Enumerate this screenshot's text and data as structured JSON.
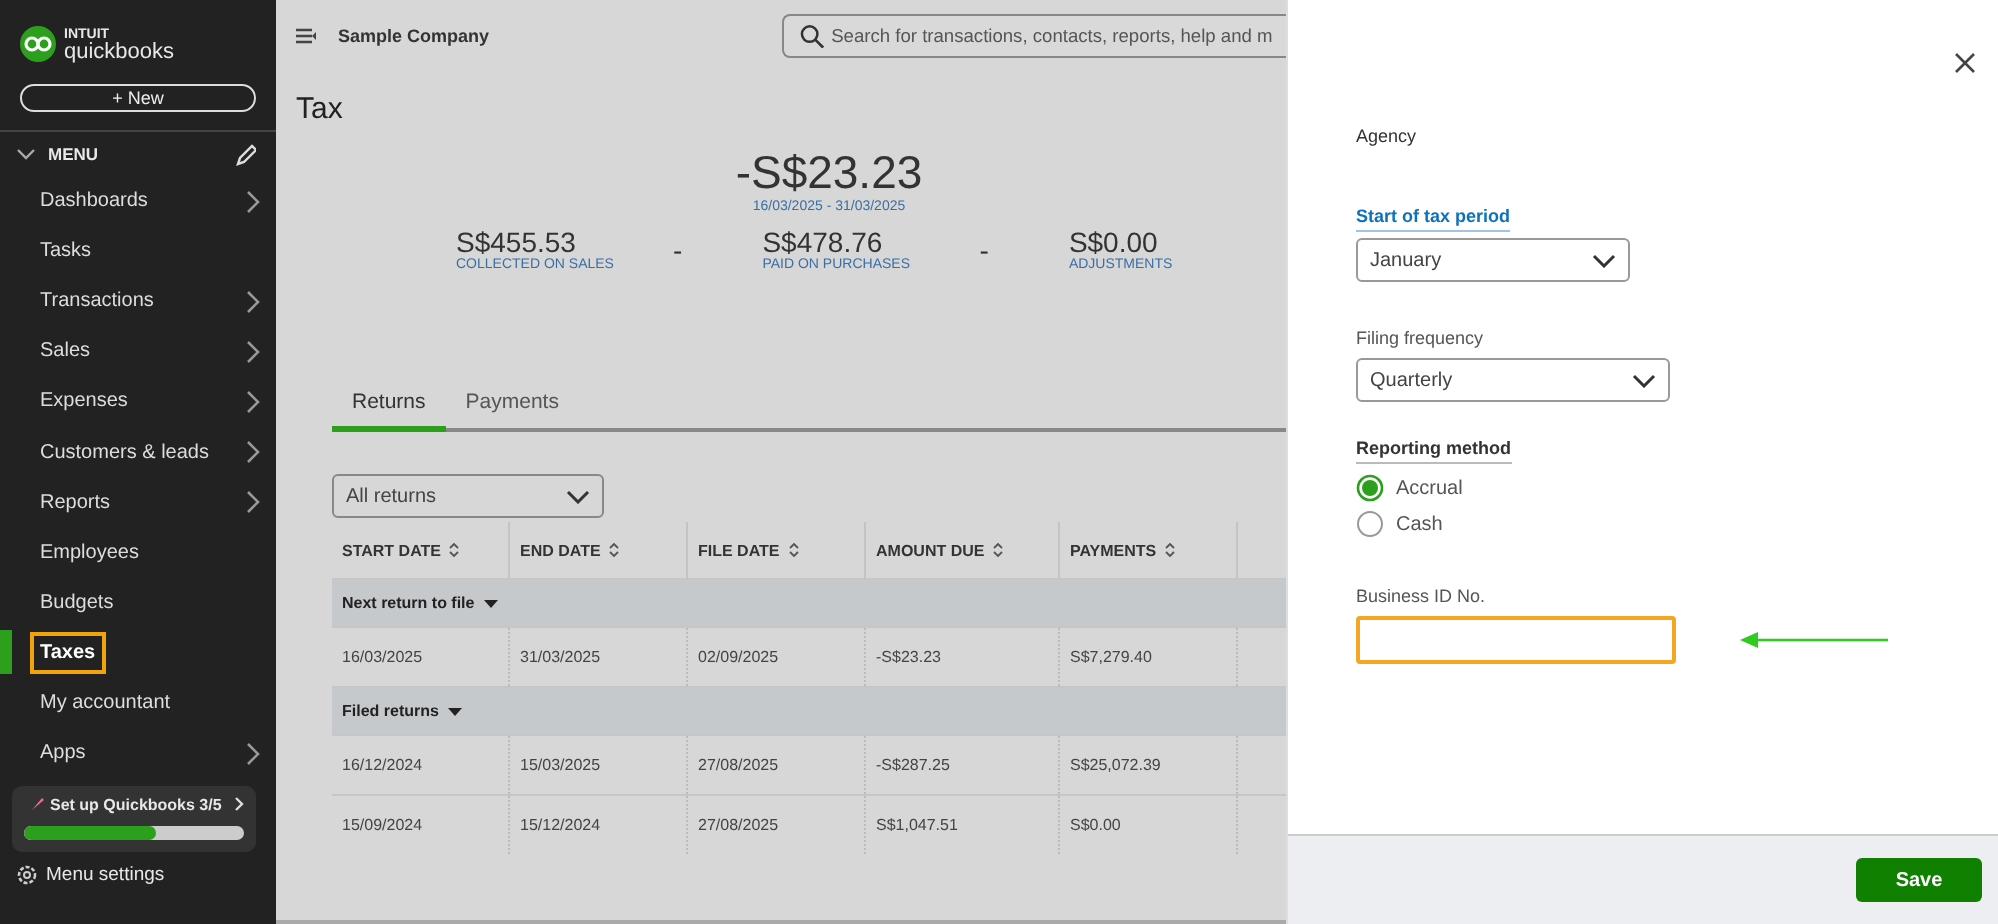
{
  "sidebar": {
    "logo_top": "INTUIT",
    "logo_name": "quickbooks",
    "new_button": "+ New",
    "menu_label": "MENU",
    "items": [
      {
        "label": "Dashboards",
        "expandable": true,
        "selected": false,
        "highlighted": false
      },
      {
        "label": "Tasks",
        "expandable": false,
        "selected": false,
        "highlighted": false
      },
      {
        "label": "Transactions",
        "expandable": true,
        "selected": false,
        "highlighted": false
      },
      {
        "label": "Sales",
        "expandable": true,
        "selected": false,
        "highlighted": false
      },
      {
        "label": "Expenses",
        "expandable": true,
        "selected": false,
        "highlighted": false
      },
      {
        "label": "Customers & leads",
        "expandable": true,
        "selected": false,
        "highlighted": false
      },
      {
        "label": "Reports",
        "expandable": true,
        "selected": false,
        "highlighted": false
      },
      {
        "label": "Employees",
        "expandable": false,
        "selected": false,
        "highlighted": false
      },
      {
        "label": "Budgets",
        "expandable": false,
        "selected": false,
        "highlighted": false
      },
      {
        "label": "Taxes",
        "expandable": false,
        "selected": true,
        "highlighted": true
      },
      {
        "label": "My accountant",
        "expandable": false,
        "selected": false,
        "highlighted": false
      },
      {
        "label": "Apps",
        "expandable": true,
        "selected": false,
        "highlighted": false
      }
    ],
    "setup": {
      "label": "Set up Quickbooks 3/5",
      "level": 0.6
    },
    "settings": "Menu settings"
  },
  "header": {
    "company": "Sample Company",
    "search": {
      "placeholder": "Search for transactions, contacts, reports, help and m"
    }
  },
  "page": {
    "title": "Tax",
    "summary": {
      "total": "-S$23.23",
      "period": "16/03/2025 - 31/03/2025",
      "parts": [
        {
          "kind": "amount",
          "amount": "S$455.53",
          "label": "COLLECTED ON SALES"
        },
        {
          "kind": "operator",
          "amount": "-"
        },
        {
          "kind": "amount",
          "amount": "S$478.76",
          "label": "PAID ON PURCHASES"
        },
        {
          "kind": "operator",
          "amount": "-"
        },
        {
          "kind": "amount",
          "amount": "S$0.00",
          "label": "ADJUSTMENTS"
        }
      ]
    },
    "tabs": [
      {
        "label": "Returns",
        "selected": true
      },
      {
        "label": "Payments",
        "selected": false
      }
    ],
    "filter": {
      "value": "All returns"
    },
    "table": {
      "columns": [
        "START DATE",
        "END DATE",
        "FILE DATE",
        "AMOUNT DUE",
        "PAYMENTS"
      ],
      "groups": [
        {
          "label": "Next return to file",
          "expanded": true,
          "rows": [
            [
              "16/03/2025",
              "31/03/2025",
              "02/09/2025",
              "-S$23.23",
              "S$7,279.40"
            ]
          ]
        },
        {
          "label": "Filed returns",
          "expanded": true,
          "rows": [
            [
              "16/12/2024",
              "15/03/2025",
              "27/08/2025",
              "-S$287.25",
              "S$25,072.39"
            ],
            [
              "15/09/2024",
              "15/12/2024",
              "27/08/2025",
              "S$1,047.51",
              "S$0.00"
            ]
          ]
        }
      ]
    }
  },
  "panel": {
    "heading": "Agency",
    "fields": [
      {
        "kind": "select",
        "label": "Start of tax period",
        "link": true,
        "underlined": true,
        "value": "January"
      },
      {
        "kind": "select",
        "label": "Filing frequency",
        "link": false,
        "underlined": false,
        "value": "Quarterly"
      },
      {
        "kind": "radio",
        "label": "Reporting method",
        "link": false,
        "underlined": true,
        "options": [
          {
            "label": "Accrual",
            "selected": true
          },
          {
            "label": "Cash",
            "selected": false
          }
        ]
      },
      {
        "kind": "text",
        "label": "Business ID No.",
        "link": false,
        "underlined": false,
        "highlighted": true
      }
    ],
    "save_button": "Save"
  }
}
